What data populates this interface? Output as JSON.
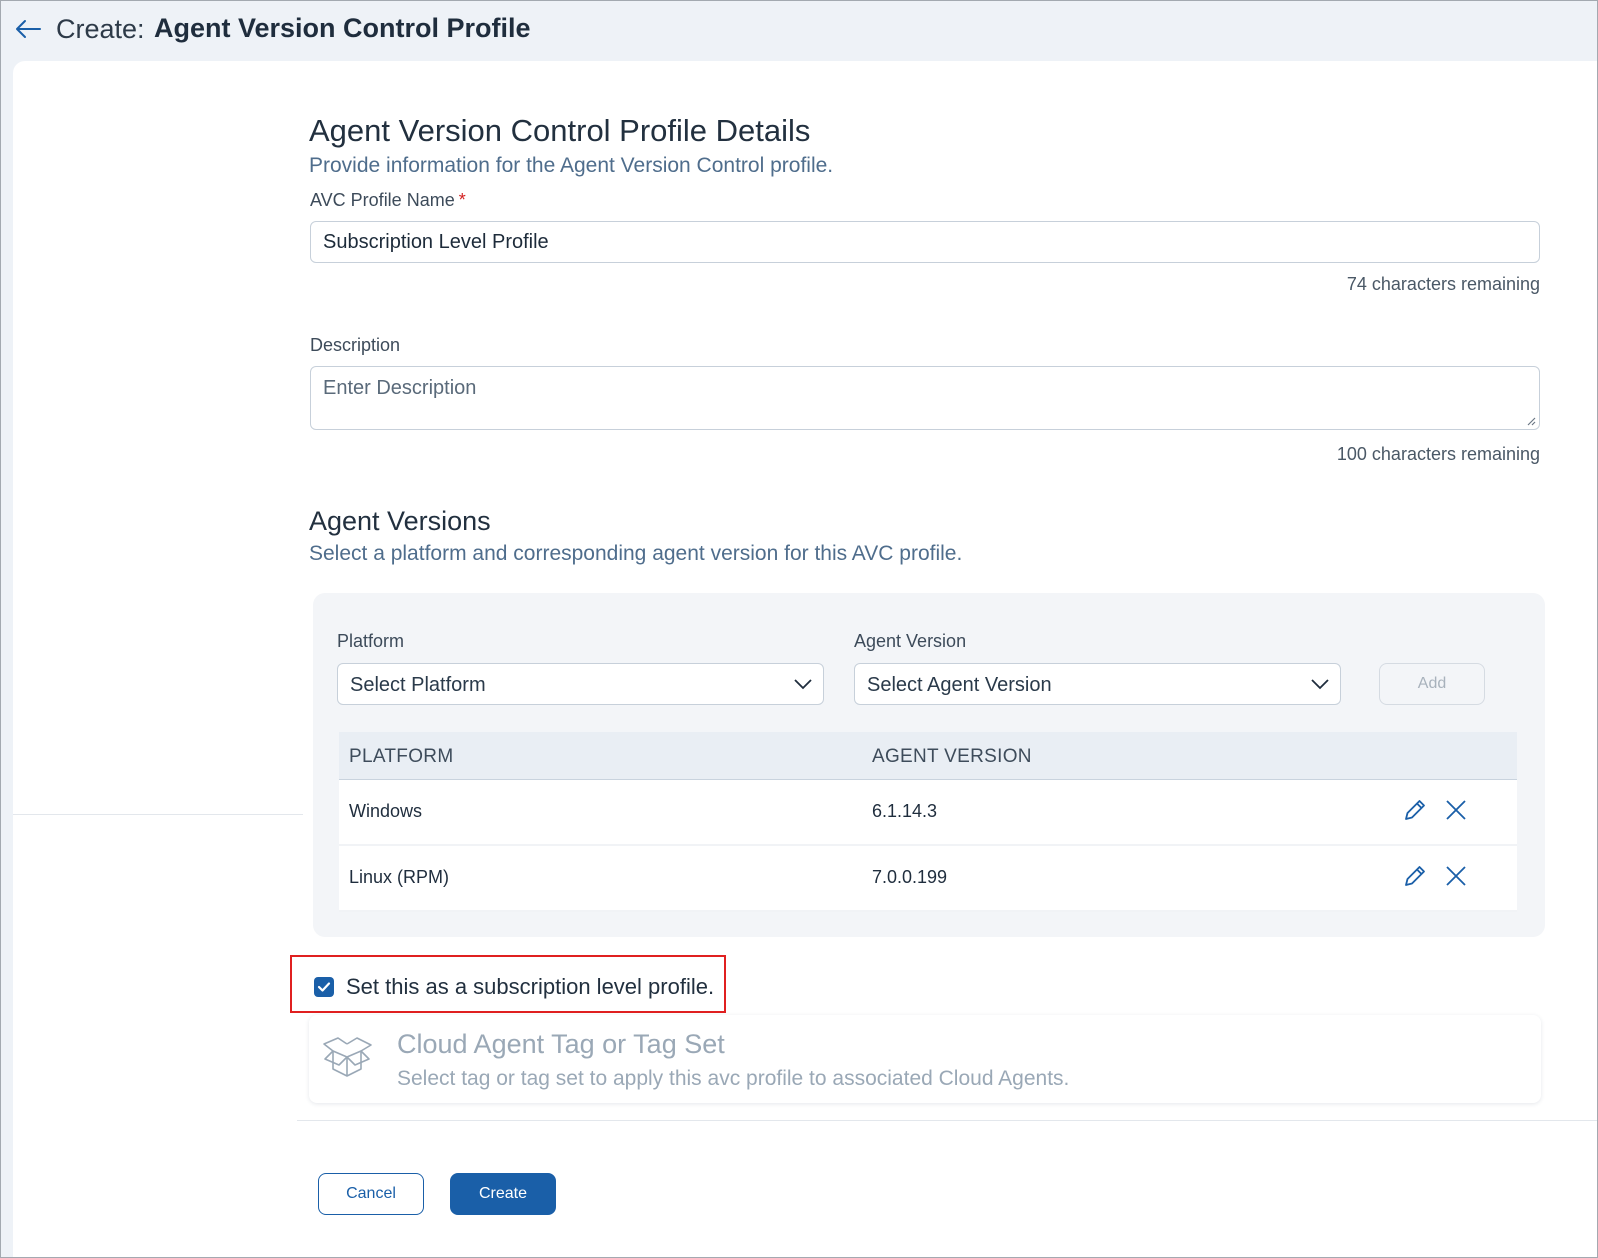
{
  "header": {
    "create_label": "Create:",
    "title": "Agent Version Control Profile"
  },
  "details": {
    "title": "Agent Version Control Profile Details",
    "subtitle": "Provide information for the Agent Version Control profile.",
    "name_label": "AVC Profile Name",
    "required_mark": "*",
    "name_value": "Subscription Level Profile",
    "name_counter": "74 characters remaining",
    "description_label": "Description",
    "description_placeholder": "Enter Description",
    "description_counter": "100 characters remaining"
  },
  "versions": {
    "title": "Agent Versions",
    "subtitle": "Select a platform and corresponding agent version for this AVC profile.",
    "platform_label": "Platform",
    "platform_placeholder": "Select Platform",
    "agent_version_label": "Agent Version",
    "agent_version_placeholder": "Select Agent Version",
    "add_label": "Add",
    "table": {
      "headers": [
        "PLATFORM",
        "AGENT VERSION"
      ],
      "rows": [
        {
          "platform": "Windows",
          "version": "6.1.14.3"
        },
        {
          "platform": "Linux (RPM)",
          "version": "7.0.0.199"
        }
      ]
    }
  },
  "subscription": {
    "checked": true,
    "label": "Set this as a subscription level profile."
  },
  "tag": {
    "title": "Cloud Agent Tag or Tag Set",
    "subtitle": "Select tag or tag set to apply this avc profile to associated Cloud Agents."
  },
  "footer": {
    "cancel_label": "Cancel",
    "create_label": "Create"
  },
  "colors": {
    "primary": "#1a5fa8",
    "highlight": "#e02020",
    "required": "#d21f1f"
  }
}
